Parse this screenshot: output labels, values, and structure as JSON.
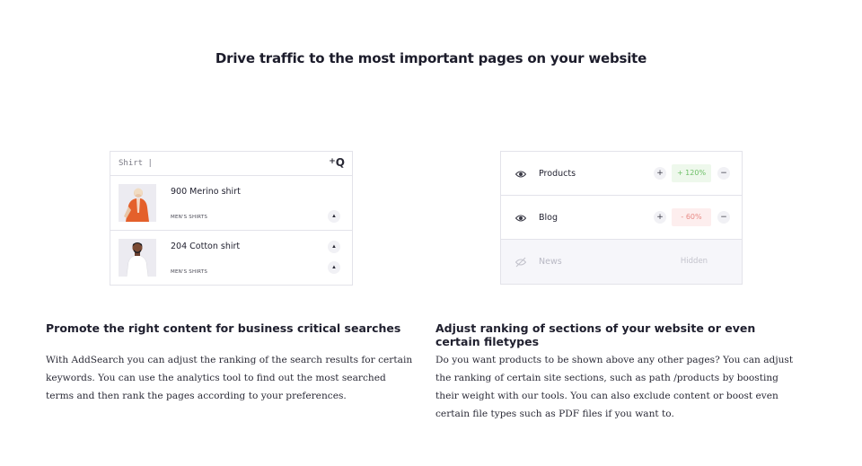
{
  "headline": "Drive traffic to the most important pages on your website",
  "search_demo": {
    "query": "Shirt |",
    "button_symbol": "Q",
    "button_plus": "+",
    "results": [
      {
        "name": "900 Merino shirt",
        "category": "MEN'S SHIRTS",
        "arrow": "▲"
      },
      {
        "name": "204 Cotton shirt",
        "category": "MEN'S SHIRTS",
        "arrow": "▲"
      }
    ],
    "icons": [
      "search-icon",
      "up-arrow-icon"
    ]
  },
  "sections_demo": {
    "rows": [
      {
        "name": "Products",
        "value": "+ 120%",
        "plus": "+",
        "minus": "−"
      },
      {
        "name": "Blog",
        "value": "- 60%",
        "plus": "+",
        "minus": "−"
      },
      {
        "name": "News",
        "status": "Hidden"
      }
    ],
    "colors": {
      "positive": "#6dbf67",
      "negative": "#e88a85"
    },
    "icons": [
      "eye-icon",
      "eye-off-icon"
    ]
  },
  "columns": {
    "left": {
      "title": "Promote the right content for business critical searches",
      "body": "With AddSearch you can adjust the ranking of the search results for certain keywords. You can use the analytics tool to find out the most searched terms and then rank the pages according to your preferences."
    },
    "right": {
      "title": "Adjust ranking of sections of your website or even certain filetypes",
      "body": "Do you want products to be shown above any other pages? You can adjust the ranking of certain site sections, such as path /products by boosting their weight with our tools. You can also exclude content or boost even certain file types such as PDF files if you want to."
    }
  }
}
